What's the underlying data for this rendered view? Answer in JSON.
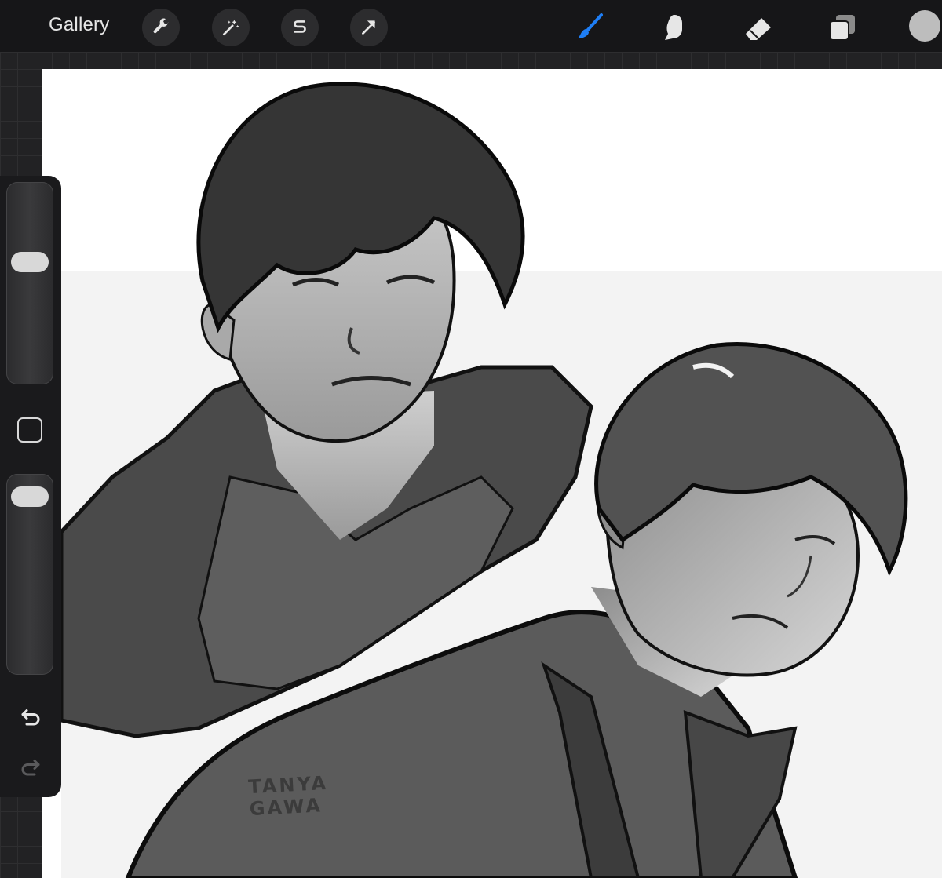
{
  "toolbar": {
    "gallery_label": "Gallery",
    "left_tools": [
      {
        "icon": "wrench-icon",
        "name": "actions"
      },
      {
        "icon": "magic-wand-icon",
        "name": "adjustments"
      },
      {
        "icon": "selection-s-icon",
        "name": "selection"
      },
      {
        "icon": "arrow-cursor-icon",
        "name": "transform"
      }
    ],
    "right_tools": [
      {
        "icon": "brush-icon",
        "name": "paint",
        "active": true
      },
      {
        "icon": "smudge-icon",
        "name": "smudge"
      },
      {
        "icon": "eraser-icon",
        "name": "erase"
      },
      {
        "icon": "layers-icon",
        "name": "layers"
      }
    ],
    "active_color": "#bdbdbd",
    "accent_color": "#1e7ef5"
  },
  "sidebar": {
    "brush_size_level": 0.62,
    "opacity_level": 0.95,
    "undo_icon": "undo-arrow-icon",
    "redo_icon": "redo-arrow-icon"
  },
  "canvas": {
    "signature": "TANYA\nGAWA"
  }
}
